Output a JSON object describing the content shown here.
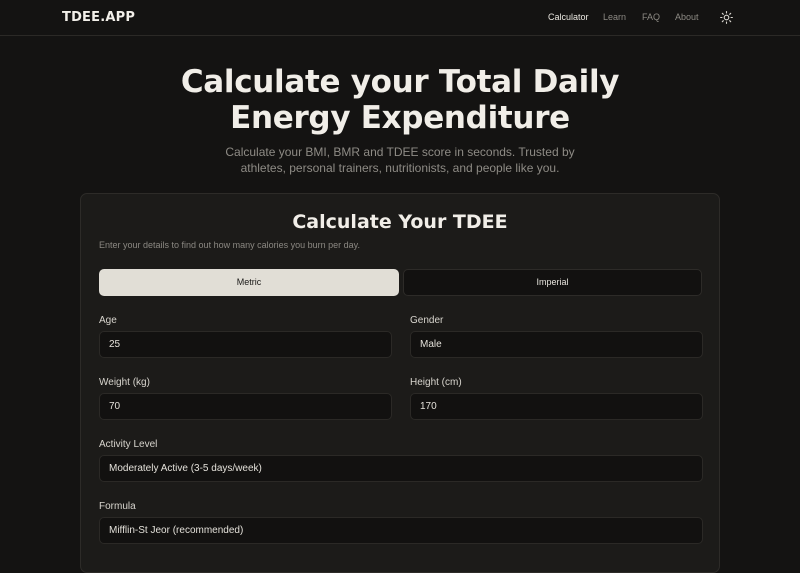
{
  "nav": {
    "brand": "TDEE.APP",
    "links": [
      {
        "label": "Calculator",
        "active": true
      },
      {
        "label": "Learn",
        "active": false
      },
      {
        "label": "FAQ",
        "active": false
      },
      {
        "label": "About",
        "active": false
      }
    ],
    "theme_icon": "sun-icon"
  },
  "hero": {
    "title_line1": "Calculate your Total Daily",
    "title_line2": "Energy Expenditure",
    "subtitle_line1": "Calculate your BMI, BMR and TDEE score in seconds. Trusted by",
    "subtitle_line2": "athletes, personal trainers, nutritionists, and people like you."
  },
  "card": {
    "title": "Calculate Your TDEE",
    "description": "Enter your details to find out how many calories you burn per day.",
    "units": {
      "metric": "Metric",
      "imperial": "Imperial",
      "selected": "Metric"
    },
    "fields": {
      "age": {
        "label": "Age",
        "value": "25"
      },
      "gender": {
        "label": "Gender",
        "value": "Male"
      },
      "weight": {
        "label": "Weight (kg)",
        "value": "70"
      },
      "height": {
        "label": "Height (cm)",
        "value": "170"
      },
      "activity": {
        "label": "Activity Level",
        "value": "Moderately Active (3-5 days/week)"
      },
      "formula": {
        "label": "Formula",
        "value": "Mifflin-St Jeor (recommended)"
      }
    }
  },
  "colors": {
    "background": "#141312",
    "card": "#1c1b19",
    "selected_toggle": "#e1ded6"
  }
}
